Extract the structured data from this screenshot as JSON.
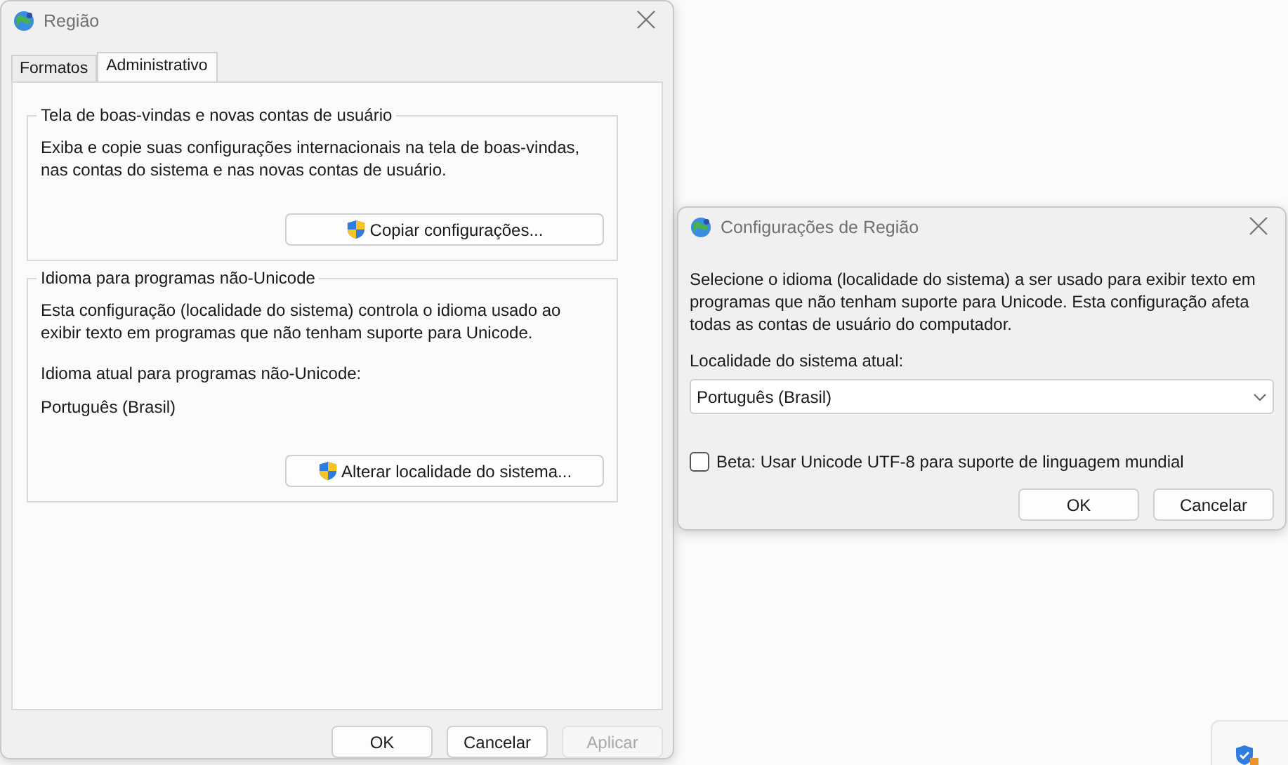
{
  "main_window": {
    "title": "Região",
    "tabs": [
      {
        "label": "Formatos",
        "selected": false
      },
      {
        "label": "Administrativo",
        "selected": true
      }
    ],
    "groups": [
      {
        "title": "Tela de boas-vindas e novas contas de usuário",
        "description": "Exiba e copie suas configurações internacionais na tela de boas-vindas, nas contas do sistema e nas novas contas de usuário.",
        "button": "Copiar configurações..."
      },
      {
        "title": "Idioma para programas não-Unicode",
        "description": "Esta configuração (localidade do sistema) controla o idioma usado ao exibir texto em programas que não tenham suporte para Unicode.",
        "current_label": "Idioma atual para programas não-Unicode:",
        "current_value": "Português (Brasil)",
        "button": "Alterar localidade do sistema..."
      }
    ],
    "buttons": [
      {
        "label": "OK",
        "disabled": false
      },
      {
        "label": "Cancelar",
        "disabled": false
      },
      {
        "label": "Aplicar",
        "disabled": true
      }
    ]
  },
  "dialog": {
    "title": "Configurações de Região",
    "description": "Selecione o idioma (localidade do sistema) a ser usado para exibir texto em programas que não tenham suporte para Unicode. Esta configuração afeta todas as contas de usuário do computador.",
    "locale_label": "Localidade do sistema atual:",
    "locale_value": "Português (Brasil)",
    "beta_option": {
      "label": "Beta: Usar Unicode UTF-8 para suporte de linguagem mundial",
      "checked": false
    },
    "buttons": [
      {
        "label": "OK",
        "disabled": false
      },
      {
        "label": "Cancelar",
        "disabled": false
      }
    ]
  }
}
